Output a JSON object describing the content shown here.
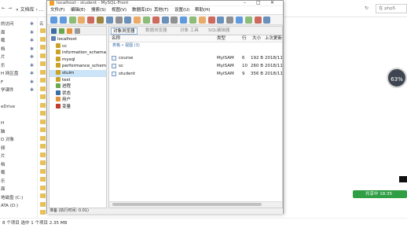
{
  "explorer": {
    "nav_text": "« 文档库 › ...",
    "search_placeholder": "在 php5",
    "left_items": [
      "的访问",
      "面",
      "载",
      "档",
      "片",
      "乐",
      "H 网区盘",
      "F",
      "学课件",
      "",
      "eDrive",
      "",
      "H",
      "脑",
      "D 对象",
      "频",
      "片",
      "档",
      "载",
      "乐",
      "面",
      "地磁盘 (C:)",
      "ATA (D:)"
    ],
    "status_text": "8 个项目    选中 1 个项目  2.35 MB",
    "mid_label": "名"
  },
  "overlay": {
    "speed": "63",
    "speed_unit": "%",
    "chat_badge": "共享中 18:35"
  },
  "mysqlfront": {
    "title": "localhost - student - MySQL-Front",
    "menus": [
      "文件(F)",
      "编辑(E)",
      "搜索(S)",
      "视图(V)",
      "数据库(D)",
      "其他(T)",
      "设置(U)",
      "帮助(H)"
    ],
    "tabs": [
      "对象浏览器",
      "数据浏览器",
      "对象 工具",
      "SQL编辑器"
    ],
    "columns": [
      "名称",
      "类型",
      "行",
      "大小",
      "上次更新"
    ],
    "breadcrumb": "表格 • 视图 (3)",
    "tree": [
      "localhost",
      "cc",
      "information_schema",
      "mysql",
      "performance_schema",
      "stuim",
      "test",
      "进程",
      "状态",
      "用户",
      "变量"
    ],
    "rows": [
      {
        "name": "course",
        "type": "MyISAM",
        "rows": "6",
        "size": "192 B",
        "updated": "2018/11/"
      },
      {
        "name": "sc",
        "type": "MyISAM",
        "rows": "10",
        "size": "260 B",
        "updated": "2018/11/"
      },
      {
        "name": "student",
        "type": "MyISAM",
        "rows": "9",
        "size": "356 B",
        "updated": "2018/11/"
      }
    ],
    "status": "准备 (执行时间: 0.01)",
    "colors": {
      "accent": "#3a6ea5",
      "selected": "#cce4f7"
    }
  }
}
